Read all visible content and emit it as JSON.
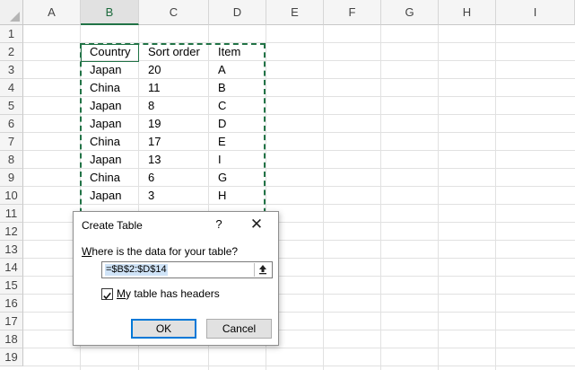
{
  "sheet": {
    "columns": [
      "A",
      "B",
      "C",
      "D",
      "E",
      "F",
      "G",
      "H",
      "I"
    ],
    "active_column": "B",
    "rows": [
      "1",
      "2",
      "3",
      "4",
      "5",
      "6",
      "7",
      "8",
      "9",
      "10",
      "11",
      "12",
      "13",
      "14",
      "15",
      "16",
      "17",
      "18",
      "19"
    ],
    "cells": {
      "headers": [
        "Country",
        "Sort order",
        "Item"
      ],
      "data": [
        [
          "Japan",
          "20",
          "A"
        ],
        [
          "China",
          "11",
          "B"
        ],
        [
          "Japan",
          "8",
          "C"
        ],
        [
          "Japan",
          "19",
          "D"
        ],
        [
          "China",
          "17",
          "E"
        ],
        [
          "Japan",
          "13",
          "I"
        ],
        [
          "China",
          "6",
          "G"
        ],
        [
          "Japan",
          "3",
          "H"
        ]
      ]
    }
  },
  "dialog": {
    "title": "Create Table",
    "help_label": "?",
    "close_label": "✕",
    "question_accel": "W",
    "question_rest": "here is the data for your table?",
    "range_value": "=$B$2:$D$14",
    "checkbox_checked": true,
    "checkbox_accel": "M",
    "checkbox_rest": "y table has headers",
    "ok_label": "OK",
    "cancel_label": "Cancel"
  },
  "colors": {
    "accent_green": "#217346",
    "focus_blue": "#0078d7"
  }
}
